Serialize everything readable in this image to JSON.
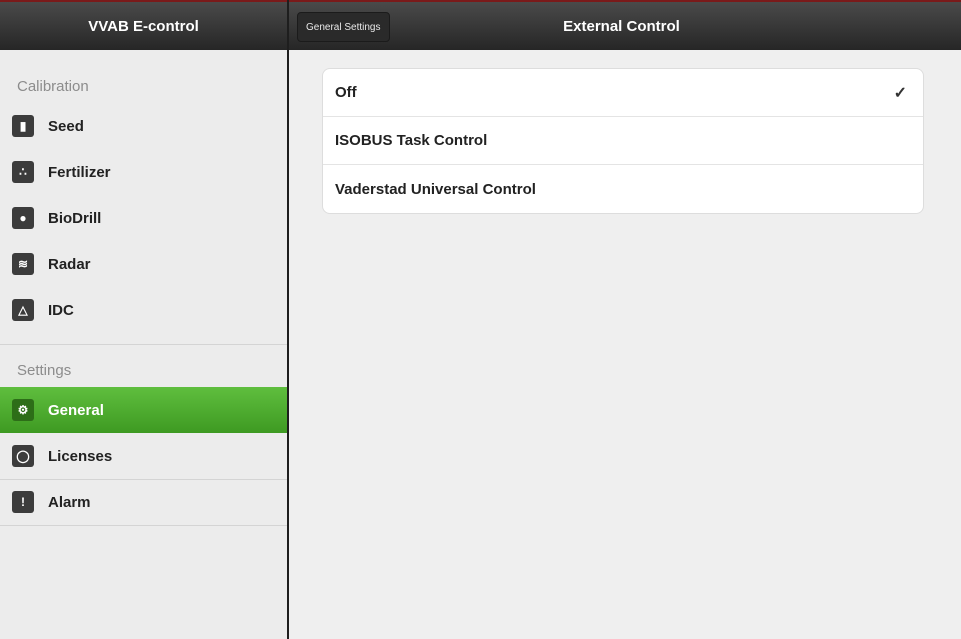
{
  "sidebar": {
    "title": "VVAB E-control",
    "sections": {
      "calibration": "Calibration",
      "settings": "Settings"
    },
    "calibration_items": [
      {
        "label": "Seed",
        "icon": "seed-icon",
        "glyph": "▮"
      },
      {
        "label": "Fertilizer",
        "icon": "fertilizer-icon",
        "glyph": "∴"
      },
      {
        "label": "BioDrill",
        "icon": "biodrill-icon",
        "glyph": "●"
      },
      {
        "label": "Radar",
        "icon": "radar-icon",
        "glyph": "≋"
      },
      {
        "label": "IDC",
        "icon": "idc-icon",
        "glyph": "△"
      }
    ],
    "settings_items": [
      {
        "label": "General",
        "icon": "gears-icon",
        "glyph": "⚙",
        "active": true
      },
      {
        "label": "Licenses",
        "icon": "license-icon",
        "glyph": "◯",
        "active": false
      },
      {
        "label": "Alarm",
        "icon": "alarm-icon",
        "glyph": "!",
        "active": false
      }
    ]
  },
  "detail": {
    "back_label": "General Settings",
    "title": "External Control",
    "options": [
      {
        "label": "Off",
        "selected": true
      },
      {
        "label": "ISOBUS Task Control",
        "selected": false
      },
      {
        "label": "Vaderstad Universal Control",
        "selected": false
      }
    ],
    "check_glyph": "✓"
  },
  "colors": {
    "active_green": "#4caf2e",
    "header_dark": "#2f2f2f",
    "accent_red": "#7a1a1a"
  }
}
